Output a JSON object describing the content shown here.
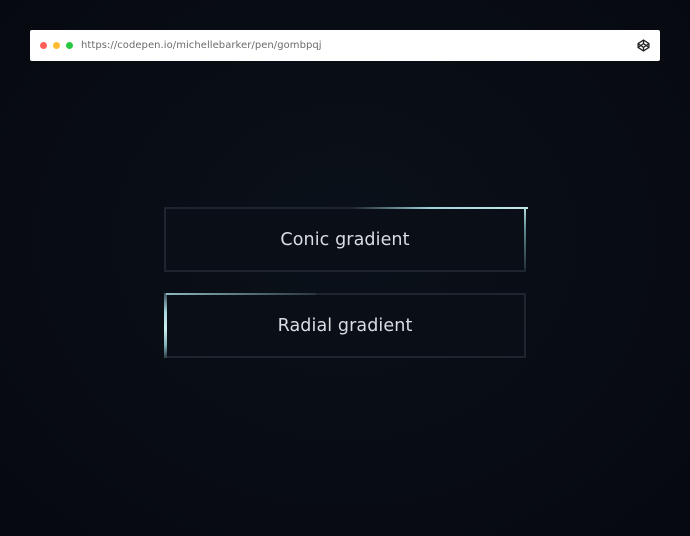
{
  "browser": {
    "url": "https://codepen.io/michellebarker/pen/gombpqj",
    "dots": [
      "#ff5f57",
      "#febc2e",
      "#28c840"
    ],
    "site_icon": "codepen-icon"
  },
  "buttons": {
    "conic": {
      "label": "Conic gradient"
    },
    "radial": {
      "label": "Radial gradient"
    }
  },
  "colors": {
    "background": "#080c13",
    "button_border": "#1e252e",
    "glow": "#c7e8ea",
    "label": "#d9dde2"
  }
}
